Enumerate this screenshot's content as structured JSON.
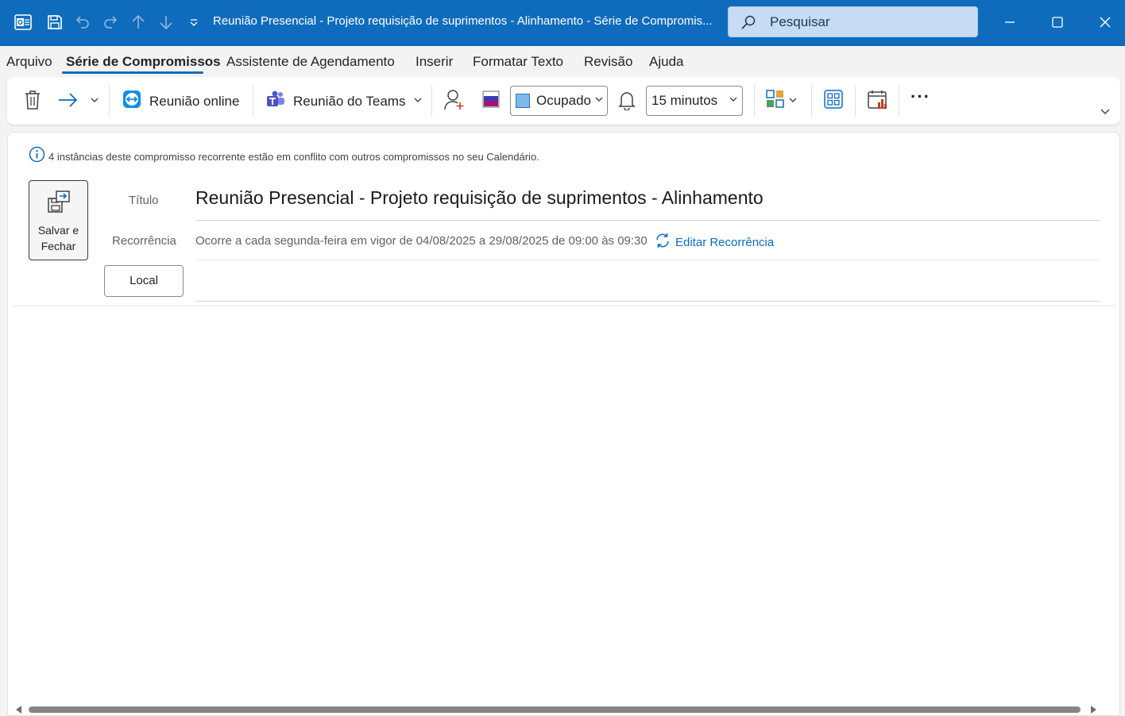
{
  "titlebar": {
    "title": "Reunião Presencial - Projeto requisição de suprimentos - Alinhamento  -  Série de Compromis...",
    "search_placeholder": "Pesquisar",
    "accent": "#0f6cbd"
  },
  "menu": {
    "items": [
      "Arquivo",
      "Série de Compromissos",
      "Assistente de Agendamento",
      "Inserir",
      "Formatar Texto",
      "Revisão",
      "Ajuda"
    ],
    "active": "Série de Compromissos"
  },
  "ribbon": {
    "online_meeting": "Reunião online",
    "teams_meeting": "Reunião do Teams",
    "show_as": "Ocupado",
    "reminder": "15 minutos",
    "more": "···"
  },
  "form": {
    "info": "4 instâncias deste compromisso recorrente estão em conflito com outros compromissos no seu Calendário.",
    "save_close": "Salvar e Fechar",
    "title_label": "Título",
    "title_value": "Reunião Presencial - Projeto requisição de suprimentos - Alinhamento",
    "recurrence_label": "Recorrência",
    "recurrence_value": "Ocorre a cada segunda-feira em vigor de 04/08/2025 a 29/08/2025 de 09:00 às 09:30",
    "edit_recurrence": "Editar Recorrência",
    "location_button": "Local",
    "location_value": ""
  }
}
